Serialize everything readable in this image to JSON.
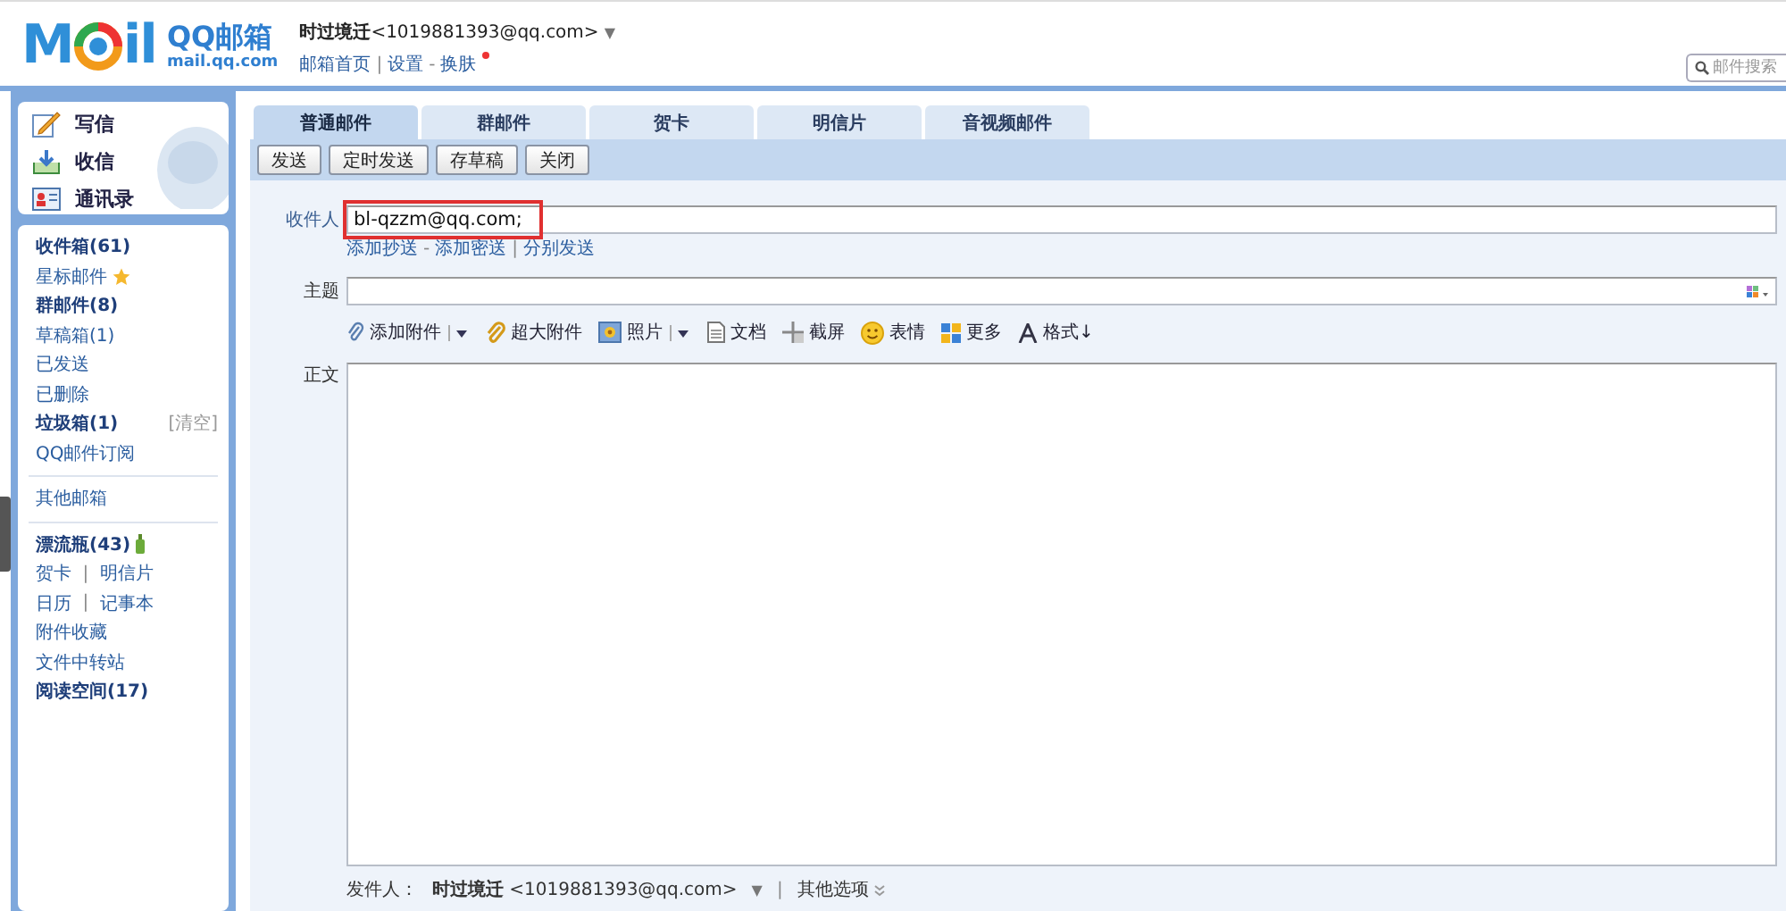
{
  "header": {
    "logo": {
      "left": "M",
      "right": "il",
      "product": "QQ邮箱",
      "domain": "mail.qq.com"
    },
    "account": "**时过境迁**<1019881393@qq.com>",
    "account_caret": "▼",
    "links": [
      "邮箱首页",
      "设置",
      "换肤"
    ],
    "link_separators": [
      "|",
      "-"
    ],
    "skin_new": true,
    "search": {
      "placeholder": "邮件搜索"
    }
  },
  "sidebar": {
    "actions": [
      {
        "label": "写信",
        "kind": "write"
      },
      {
        "label": "收信",
        "kind": "receive"
      },
      {
        "label": "通讯录",
        "kind": "contacts"
      }
    ],
    "groups": [
      [
        {
          "links": [
            "收件箱(61)"
          ],
          "bold": true
        },
        {
          "links": [
            "星标邮件"
          ],
          "bold": false,
          "kind": "star"
        },
        {
          "links": [
            "群邮件(8)"
          ],
          "bold": true
        },
        {
          "links": [
            "草稿箱(1)"
          ],
          "bold": false
        },
        {
          "links": [
            "已发送"
          ],
          "bold": false
        },
        {
          "links": [
            "已删除"
          ],
          "bold": false
        },
        {
          "links": [
            "垃圾箱(1)"
          ],
          "bold": true,
          "action": "[清空]"
        },
        {
          "links": [
            "QQ邮件订阅"
          ],
          "bold": false
        }
      ],
      [
        {
          "links": [
            "其他邮箱"
          ],
          "bold": false
        }
      ],
      [
        {
          "links": [
            "漂流瓶(43)"
          ],
          "bold": true,
          "kind": "bottle"
        },
        {
          "links": [
            "贺卡",
            "明信片"
          ],
          "bold": false,
          "separator": "|"
        },
        {
          "links": [
            "日历",
            "记事本"
          ],
          "bold": false,
          "separator": "|"
        },
        {
          "links": [
            "附件收藏"
          ],
          "bold": false
        },
        {
          "links": [
            "文件中转站"
          ],
          "bold": false
        },
        {
          "links": [
            "阅读空间(17)"
          ],
          "bold": true
        }
      ]
    ]
  },
  "compose": {
    "tabs": [
      {
        "label": "普通邮件",
        "selected": true
      },
      {
        "label": "群邮件",
        "selected": false
      },
      {
        "label": "贺卡",
        "selected": false
      },
      {
        "label": "明信片",
        "selected": false
      },
      {
        "label": "音视频邮件",
        "selected": false
      }
    ],
    "buttons": [
      "发送",
      "定时发送",
      "存草稿",
      "关闭"
    ],
    "to": {
      "label": "收件人",
      "value": "bl-qzzm@qq.com;",
      "highlighted": true
    },
    "to_links": [
      "添加抄送",
      "添加密送",
      "分别发送"
    ],
    "to_separators": [
      "-",
      "|"
    ],
    "subject": {
      "label": "主题"
    },
    "tools": [
      {
        "label": "添加附件",
        "kind": "clip",
        "menu": true
      },
      {
        "label": "超大附件",
        "kind": "bigclip",
        "menu": false
      },
      {
        "label": "照片",
        "kind": "photo",
        "menu": true
      },
      {
        "label": "文档",
        "kind": "doc",
        "menu": false
      },
      {
        "label": "截屏",
        "kind": "screen",
        "menu": false
      },
      {
        "label": "表情",
        "kind": "smile",
        "menu": false
      },
      {
        "label": "更多",
        "kind": "more",
        "menu": false
      },
      {
        "label": "格式↓",
        "kind": "format",
        "menu": false
      }
    ],
    "body": {
      "label": "正文"
    },
    "footer": {
      "sender_label": "发件人：",
      "sender": "**时过境迁** <1019881393@qq.com>",
      "caret": "▼",
      "separator": "|",
      "options": "其他选项"
    }
  }
}
